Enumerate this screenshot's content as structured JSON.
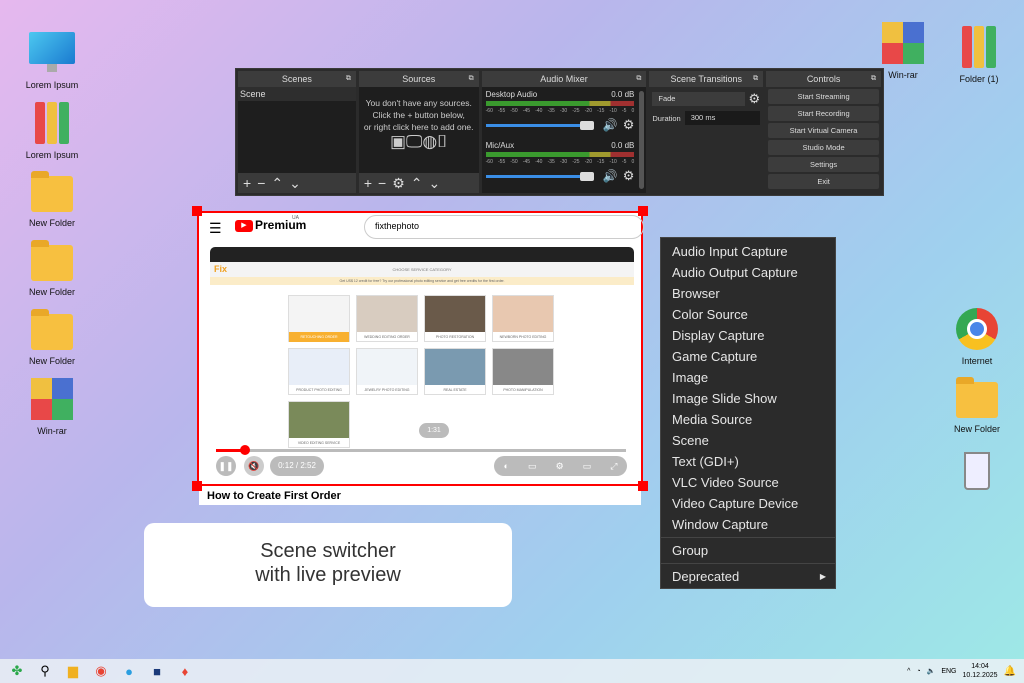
{
  "desktop": {
    "left_icons": [
      {
        "label": "Lorem Ipsum",
        "icon": "monitor-icon"
      },
      {
        "label": "Lorem Ipsum",
        "icon": "binders-icon"
      },
      {
        "label": "New Folder",
        "icon": "folder-icon"
      },
      {
        "label": "New Folder",
        "icon": "folder-icon"
      },
      {
        "label": "New Folder",
        "icon": "folder-icon"
      },
      {
        "label": "Win-rar",
        "icon": "winrar-icon"
      }
    ],
    "right_icons": [
      {
        "label": "Win-rar"
      },
      {
        "label": "Folder (1)"
      },
      {
        "label": "Internet"
      },
      {
        "label": "New Folder"
      },
      {
        "label": ""
      }
    ]
  },
  "obs": {
    "scenes": {
      "title": "Scenes",
      "items": [
        "Scene"
      ]
    },
    "sources": {
      "title": "Sources",
      "empty_text": [
        "You don't have any sources.",
        "Click the + button below,",
        "or right click here to add one."
      ]
    },
    "mixer": {
      "title": "Audio Mixer",
      "channels": [
        {
          "name": "Desktop Audio",
          "db": "0.0 dB"
        },
        {
          "name": "Mic/Aux",
          "db": "0.0 dB"
        }
      ],
      "ticks": [
        "-60",
        "-55",
        "-50",
        "-45",
        "-40",
        "-35",
        "-30",
        "-25",
        "-20",
        "-15",
        "-10",
        "-5",
        "0"
      ]
    },
    "transitions": {
      "title": "Scene Transitions",
      "selected": "Fade",
      "duration_label": "Duration",
      "duration_value": "300 ms"
    },
    "controls": {
      "title": "Controls",
      "buttons": [
        "Start Streaming",
        "Start Recording",
        "Start Virtual Camera",
        "Studio Mode",
        "Settings",
        "Exit"
      ]
    }
  },
  "preview": {
    "brand": "Premium",
    "region": "UA",
    "search": "fixthephoto",
    "site_header": "CHOOSE SERVICE CATEGORY",
    "banner": "Get US$ 12 credit for free? Try our professional photo editing service and get free credits for the first order.",
    "cards": [
      "RETOUCHING ORDER",
      "WEDDING EDITING ORDER",
      "PHOTO RESTORATION",
      "NEWBORN PHOTO EDITING",
      "PRODUCT PHOTO EDITING",
      "JEWELRY PHOTO EDITING",
      "REAL ESTATE",
      "PHOTO MANIPULATION",
      "VIDEO EDITING SERVICE"
    ],
    "hover_time": "1:31",
    "time": "0:12 / 2:52",
    "progress": 0.07,
    "video_title": "How to Create First Order"
  },
  "menu": {
    "items": [
      "Audio Input Capture",
      "Audio Output Capture",
      "Browser",
      "Color Source",
      "Display Capture",
      "Game Capture",
      "Image",
      "Image Slide Show",
      "Media Source",
      "Scene",
      "Text (GDI+)",
      "VLC Video Source",
      "Video Capture Device",
      "Window Capture"
    ],
    "group": "Group",
    "deprecated": "Deprecated"
  },
  "caption": {
    "line1": "Scene switcher",
    "line2": "with live preview"
  },
  "taskbar": {
    "lang": "ENG",
    "time": "14:04",
    "date": "10.12.2025"
  }
}
